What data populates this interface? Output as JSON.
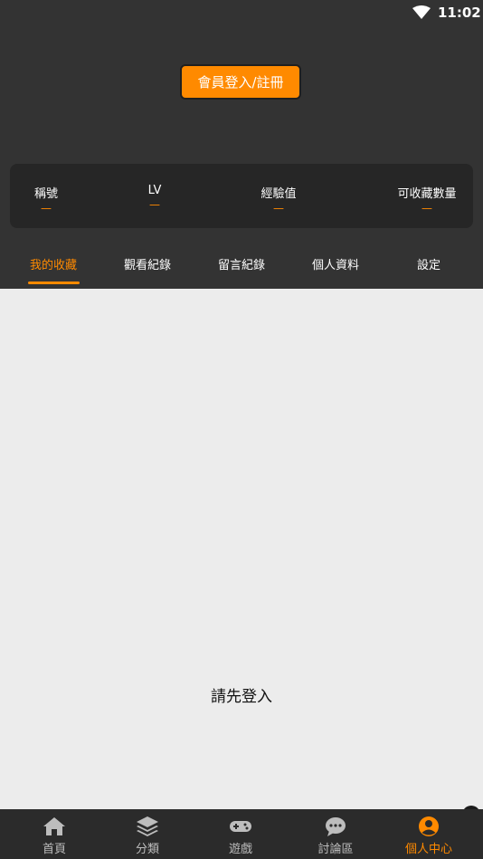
{
  "status_bar": {
    "time": "11:02"
  },
  "header": {
    "login_button": "會員登入/註冊"
  },
  "stats": [
    {
      "label": "稱號",
      "value": "—"
    },
    {
      "label": "LV",
      "value": "—"
    },
    {
      "label": "經驗值",
      "value": "—"
    },
    {
      "label": "可收藏數量",
      "value": "—"
    }
  ],
  "tabs": [
    {
      "label": "我的收藏"
    },
    {
      "label": "觀看紀錄"
    },
    {
      "label": "留言紀錄"
    },
    {
      "label": "個人資料"
    },
    {
      "label": "設定"
    }
  ],
  "content": {
    "empty_message": "請先登入"
  },
  "bottom_nav": [
    {
      "label": "首頁",
      "icon": "home-icon"
    },
    {
      "label": "分類",
      "icon": "layers-icon"
    },
    {
      "label": "遊戲",
      "icon": "gamepad-icon"
    },
    {
      "label": "討論區",
      "icon": "chat-icon"
    },
    {
      "label": "個人中心",
      "icon": "user-circle-icon"
    }
  ],
  "colors": {
    "accent": "#ff8a00",
    "header_bg": "#333333",
    "stats_bg": "#262626",
    "content_bg": "#ececec",
    "nav_bg": "#2b2b2b"
  }
}
